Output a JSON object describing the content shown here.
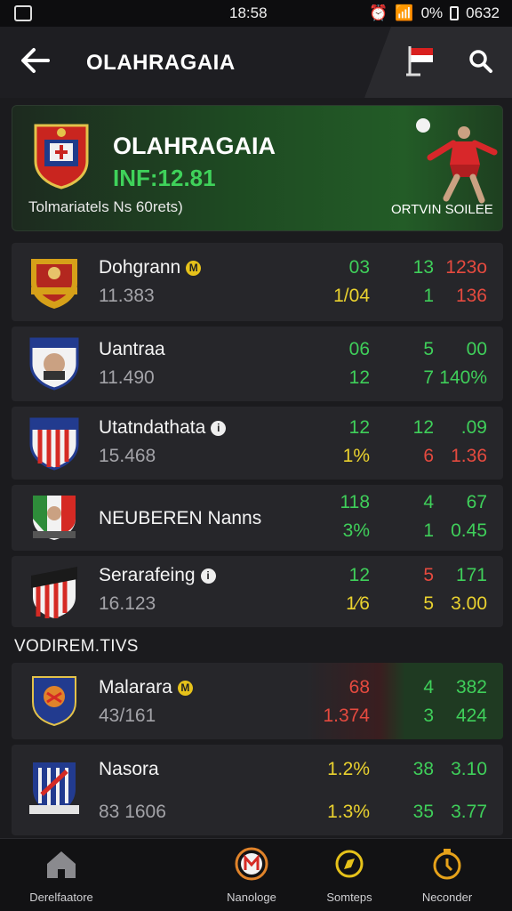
{
  "status_bar": {
    "time": "18:58",
    "battery": "0%",
    "right_text": "0632"
  },
  "header": {
    "title": "OLAHRAGAIA"
  },
  "hero": {
    "name": "OLAHRAGAIA",
    "score": "INF:12.81",
    "subtitle": "Tolmariatels Ns 60rets)",
    "player_label": "ORTVIN SOILEE"
  },
  "teams": [
    {
      "name": "Dohgrann",
      "sub": "11.383",
      "badge": "M",
      "c1": [
        "03",
        "1/04"
      ],
      "c2": [
        "13",
        "1"
      ],
      "c3": [
        "123o",
        "136"
      ]
    },
    {
      "name": "Uantraa",
      "sub": "11.490",
      "c1": [
        "06",
        "12"
      ],
      "c2": [
        "5",
        "7"
      ],
      "c3": [
        "00",
        "140%"
      ]
    },
    {
      "name": "Utatndathata",
      "sub": "15.468",
      "badge": "i",
      "c1": [
        "12",
        "1%"
      ],
      "c2": [
        "12",
        "6"
      ],
      "c3": [
        ".09",
        "1.36"
      ]
    },
    {
      "name": "NEUBEREN Nanns",
      "sub": "",
      "c1": [
        "118",
        "3%"
      ],
      "c2": [
        "4",
        "1"
      ],
      "c3": [
        "67",
        "0.45"
      ]
    },
    {
      "name": "Serarafeing",
      "sub": "16.123",
      "badge": "i",
      "c1": [
        "12",
        "1⁄6"
      ],
      "c2": [
        "5",
        "5"
      ],
      "c3": [
        "171",
        "3.00"
      ]
    }
  ],
  "section_title": "VODIREM.TIVS",
  "section_teams": [
    {
      "name": "Malarara",
      "sub": "43/161",
      "badge": "M",
      "c1": [
        "68",
        "1.374"
      ],
      "c2": [
        "4",
        "3"
      ],
      "c3": [
        "382",
        "424"
      ]
    },
    {
      "name": "Nasora",
      "sub": "83 1606",
      "c1": [
        "1.2%",
        "1.3%"
      ],
      "c2": [
        "38",
        "35"
      ],
      "c3": [
        "3.10",
        "3.77"
      ]
    }
  ],
  "tabs": [
    {
      "label": "Derelfaatore"
    },
    {
      "label": "Nanologe"
    },
    {
      "label": "Somteps"
    },
    {
      "label": "Neconder"
    }
  ],
  "colors": {
    "green": "#3fcf5a",
    "yellow": "#ead22f",
    "red": "#e54a3f",
    "background": "#1b1b1e"
  }
}
